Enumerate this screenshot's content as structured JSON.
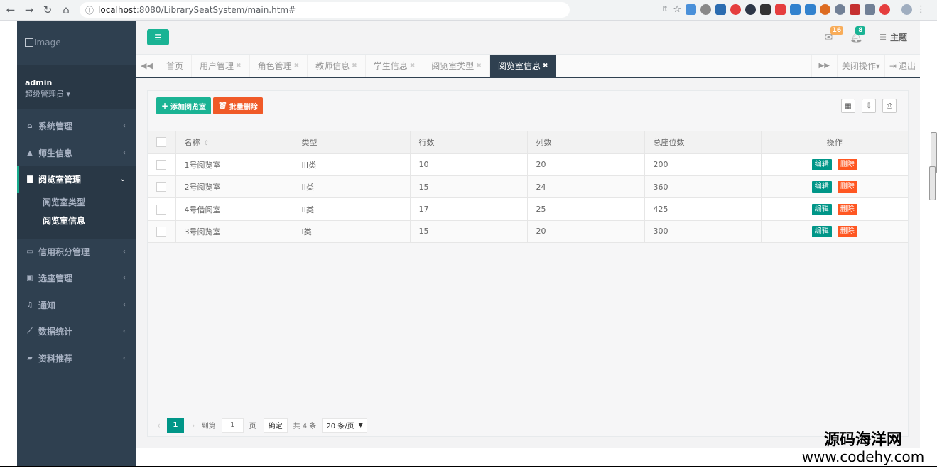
{
  "browser": {
    "url_host": "localhost",
    "url_rest": ":8080/LibrarySeatSystem/main.htm#"
  },
  "logo": {
    "alt": "Image"
  },
  "profile": {
    "name": "admin",
    "role": "超级管理员 ▾"
  },
  "menu": [
    {
      "label": "系统管理",
      "icon": "home-icon"
    },
    {
      "label": "师生信息",
      "icon": "graduation-cap-icon"
    },
    {
      "label": "阅览室管理",
      "icon": "book-icon"
    },
    {
      "label": "信用积分管理",
      "icon": "credit-card-icon"
    },
    {
      "label": "选座管理",
      "icon": "calendar-check-icon"
    },
    {
      "label": "通知",
      "icon": "bell-icon"
    },
    {
      "label": "数据统计",
      "icon": "line-chart-icon"
    },
    {
      "label": "资料推荐",
      "icon": "book-open-icon"
    }
  ],
  "submenu": [
    {
      "label": "阅览室类型"
    },
    {
      "label": "阅览室信息"
    }
  ],
  "header": {
    "mail_count": "16",
    "bell_count": "8",
    "theme_label": "主题"
  },
  "tabs": [
    {
      "label": "首页"
    },
    {
      "label": "用户管理"
    },
    {
      "label": "角色管理"
    },
    {
      "label": "教师信息"
    },
    {
      "label": "学生信息"
    },
    {
      "label": "阅览室类型"
    },
    {
      "label": "阅览室信息"
    }
  ],
  "tabs_right": {
    "close_ops": "关闭操作▾",
    "logout": "退出"
  },
  "toolbar": {
    "add_label": "添加阅览室",
    "delete_label": "批量删除"
  },
  "table": {
    "columns": [
      "名称",
      "类型",
      "行数",
      "列数",
      "总座位数",
      "操作"
    ],
    "rows": [
      {
        "name": "1号阅览室",
        "type": "III类",
        "rows": "10",
        "cols": "20",
        "total": "200"
      },
      {
        "name": "2号阅览室",
        "type": "II类",
        "rows": "15",
        "cols": "24",
        "total": "360"
      },
      {
        "name": "4号借阅室",
        "type": "II类",
        "rows": "17",
        "cols": "25",
        "total": "425"
      },
      {
        "name": "3号阅览室",
        "type": "I类",
        "rows": "15",
        "cols": "20",
        "total": "300"
      }
    ],
    "edit_label": "编辑",
    "delete_label": "删除"
  },
  "pager": {
    "current": "1",
    "goto_prefix": "到第",
    "goto_value": "1",
    "goto_suffix": "页",
    "confirm": "确定",
    "total": "共 4 条",
    "page_size": "20 条/页"
  },
  "watermark": {
    "line1": "源码海洋网",
    "line2": "www.codehy.com"
  }
}
